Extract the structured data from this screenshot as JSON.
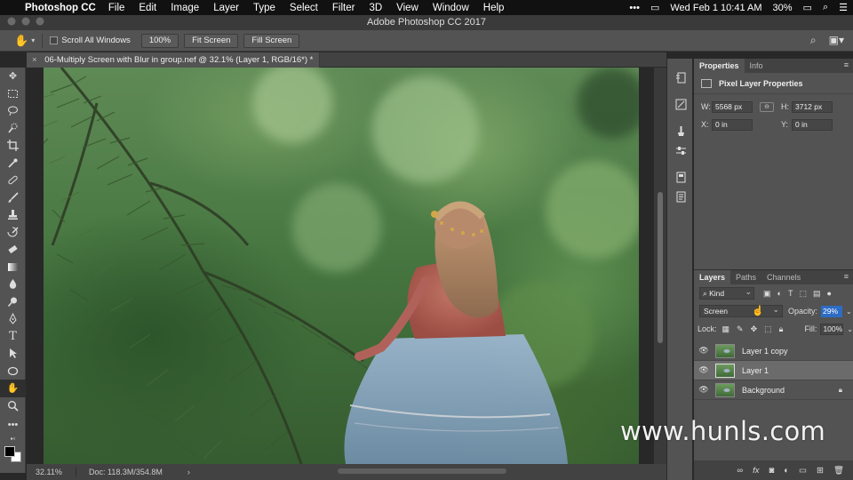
{
  "menubar": {
    "app_name": "Photoshop CC",
    "items": [
      "File",
      "Edit",
      "Image",
      "Layer",
      "Type",
      "Select",
      "Filter",
      "3D",
      "View",
      "Window",
      "Help"
    ],
    "datetime": "Wed Feb 1  10:41 AM",
    "battery": "30%"
  },
  "window": {
    "title": "Adobe Photoshop CC 2017"
  },
  "options_bar": {
    "scroll_all_windows": "Scroll All Windows",
    "zoom_100": "100%",
    "fit_screen": "Fit Screen",
    "fill_screen": "Fill Screen"
  },
  "document": {
    "tab_title": "06-Multiply Screen with Blur in group.nef @ 32.1% (Layer 1, RGB/16*) *",
    "zoom": "32.11%",
    "doc_size": "Doc: 118.3M/354.8M"
  },
  "tools": [
    "move-icon",
    "marquee-icon",
    "lasso-icon",
    "quick-select-icon",
    "crop-icon",
    "eyedropper-icon",
    "healing-icon",
    "brush-icon",
    "stamp-icon",
    "history-brush-icon",
    "eraser-icon",
    "gradient-icon",
    "blur-icon",
    "dodge-icon",
    "pen-icon",
    "type-icon",
    "path-select-icon",
    "shape-icon",
    "hand-icon",
    "zoom-icon"
  ],
  "properties_panel": {
    "tabs": [
      "Properties",
      "Info"
    ],
    "header": "Pixel Layer Properties",
    "w_label": "W:",
    "w_value": "5568 px",
    "h_label": "H:",
    "h_value": "3712 px",
    "x_label": "X:",
    "x_value": "0 in",
    "y_label": "Y:",
    "y_value": "0 in"
  },
  "layers_panel": {
    "tabs": [
      "Layers",
      "Paths",
      "Channels"
    ],
    "kind_filter": "Kind",
    "blend_mode": "Screen",
    "opacity_label": "Opacity:",
    "opacity_value": "29%",
    "lock_label": "Lock:",
    "fill_label": "Fill:",
    "fill_value": "100%",
    "layers": [
      {
        "name": "Layer 1 copy",
        "visible": true,
        "selected": false,
        "locked": false
      },
      {
        "name": "Layer 1",
        "visible": true,
        "selected": true,
        "locked": false
      },
      {
        "name": "Background",
        "visible": true,
        "selected": false,
        "locked": true
      }
    ]
  },
  "watermark": "www.hunls.com",
  "colors": {
    "selection_blue": "#2c6cc4",
    "panel_bg": "#535353",
    "dark_bg": "#282828"
  }
}
